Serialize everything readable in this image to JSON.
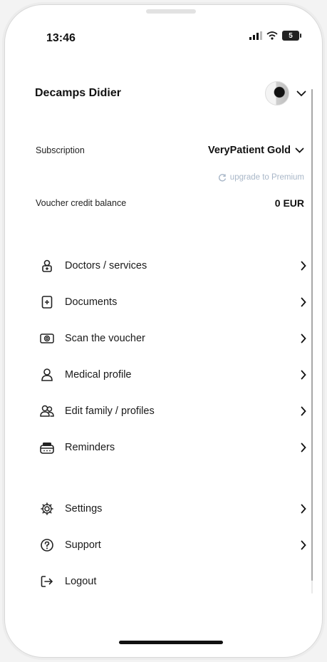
{
  "status_bar": {
    "time": "13:46",
    "battery": "5"
  },
  "header": {
    "user_name": "Decamps Didier"
  },
  "subscription": {
    "label": "Subscription",
    "plan": "VeryPatient Gold",
    "upgrade_link": "upgrade to Premium"
  },
  "voucher": {
    "label": "Voucher credit balance",
    "value": "0 EUR"
  },
  "menu": [
    {
      "label": "Doctors / services",
      "icon": "doctor-bag-icon"
    },
    {
      "label": "Documents",
      "icon": "document-plus-icon"
    },
    {
      "label": "Scan the voucher",
      "icon": "scan-voucher-icon"
    },
    {
      "label": "Medical profile",
      "icon": "user-icon"
    },
    {
      "label": "Edit family / profiles",
      "icon": "family-icon"
    },
    {
      "label": "Reminders",
      "icon": "pill-box-icon"
    }
  ],
  "menu_secondary": [
    {
      "label": "Settings",
      "icon": "gear-icon"
    },
    {
      "label": "Support",
      "icon": "help-circle-icon"
    },
    {
      "label": "Logout",
      "icon": "logout-icon"
    }
  ],
  "colors": {
    "accent_muted": "#a9b7c8",
    "text": "#111111",
    "background": "#ffffff"
  }
}
